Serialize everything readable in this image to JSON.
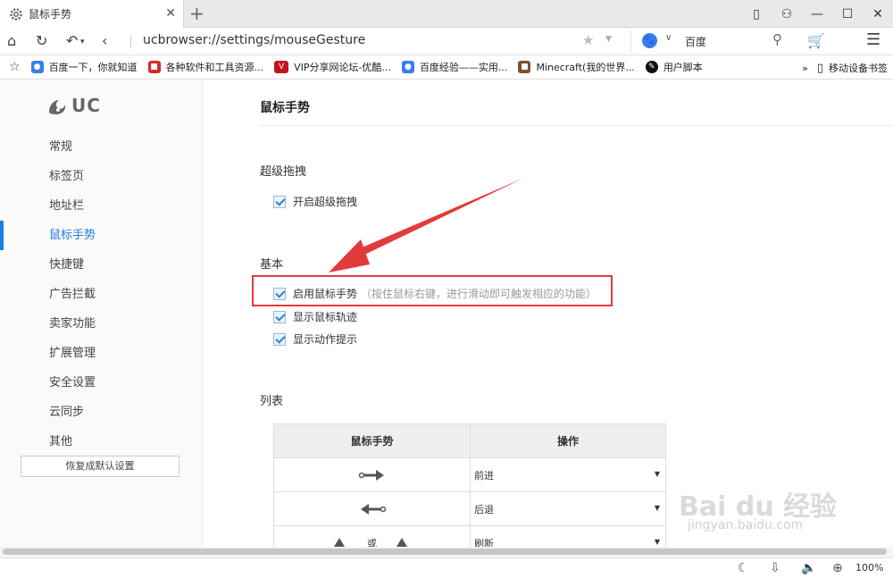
{
  "tab": {
    "title": "鼠标手势",
    "close": "✕",
    "new": "+"
  },
  "window_controls": [
    "▯",
    "⚇",
    "—",
    "☐",
    "✕"
  ],
  "nav": {
    "url": "ucbrowser://settings/mouseGesture",
    "search_engine": "百度"
  },
  "bookmarks": [
    {
      "label": "百度一下，你就知道",
      "icon": "baidu-paw",
      "color": "#3a7bf2"
    },
    {
      "label": "各种软件和工具资源...",
      "icon": "red-square",
      "color": "#d42b2b"
    },
    {
      "label": "VIP分享网论坛-优酷...",
      "icon": "vip",
      "color": "#c1121f"
    },
    {
      "label": "百度经验——实用...",
      "icon": "baidu-paw",
      "color": "#3a7bf2"
    },
    {
      "label": "Minecraft(我的世界...",
      "icon": "block",
      "color": "#7a5230"
    },
    {
      "label": "用户脚本",
      "icon": "script",
      "color": "#111111"
    }
  ],
  "bookmarks_more": "»",
  "mobile_bookmarks": "移动设备书签",
  "sidebar": {
    "logo_text": "UC",
    "items": [
      "常规",
      "标签页",
      "地址栏",
      "鼠标手势",
      "快捷键",
      "广告拦截",
      "卖家功能",
      "扩展管理",
      "安全设置",
      "云同步",
      "其他"
    ],
    "active_index": 3,
    "reset_label": "恢复成默认设置"
  },
  "main": {
    "title": "鼠标手势",
    "sections": {
      "super_drag": {
        "heading": "超级拖拽",
        "option": "开启超级拖拽"
      },
      "basic": {
        "heading": "基本",
        "enable_gesture": "启用鼠标手势",
        "enable_hint": "（按住鼠标右键，进行滑动即可触发相应的功能）",
        "show_trail": "显示鼠标轨迹",
        "show_action": "显示动作提示"
      },
      "list": {
        "heading": "列表"
      }
    },
    "table": {
      "headers": [
        "鼠标手势",
        "操作"
      ],
      "rows": [
        {
          "gesture": "right",
          "action": "前进"
        },
        {
          "gesture": "left",
          "action": "后退"
        },
        {
          "gesture": "up-or",
          "gesture_text": "或",
          "action": "刷新"
        }
      ]
    }
  },
  "status": {
    "zoom": "100%"
  },
  "watermark": {
    "main": "Bai du 经验",
    "sub": "jingyan.baidu.com"
  },
  "colors": {
    "accent": "#1f7fe0",
    "highlight": "#e23b3b"
  }
}
